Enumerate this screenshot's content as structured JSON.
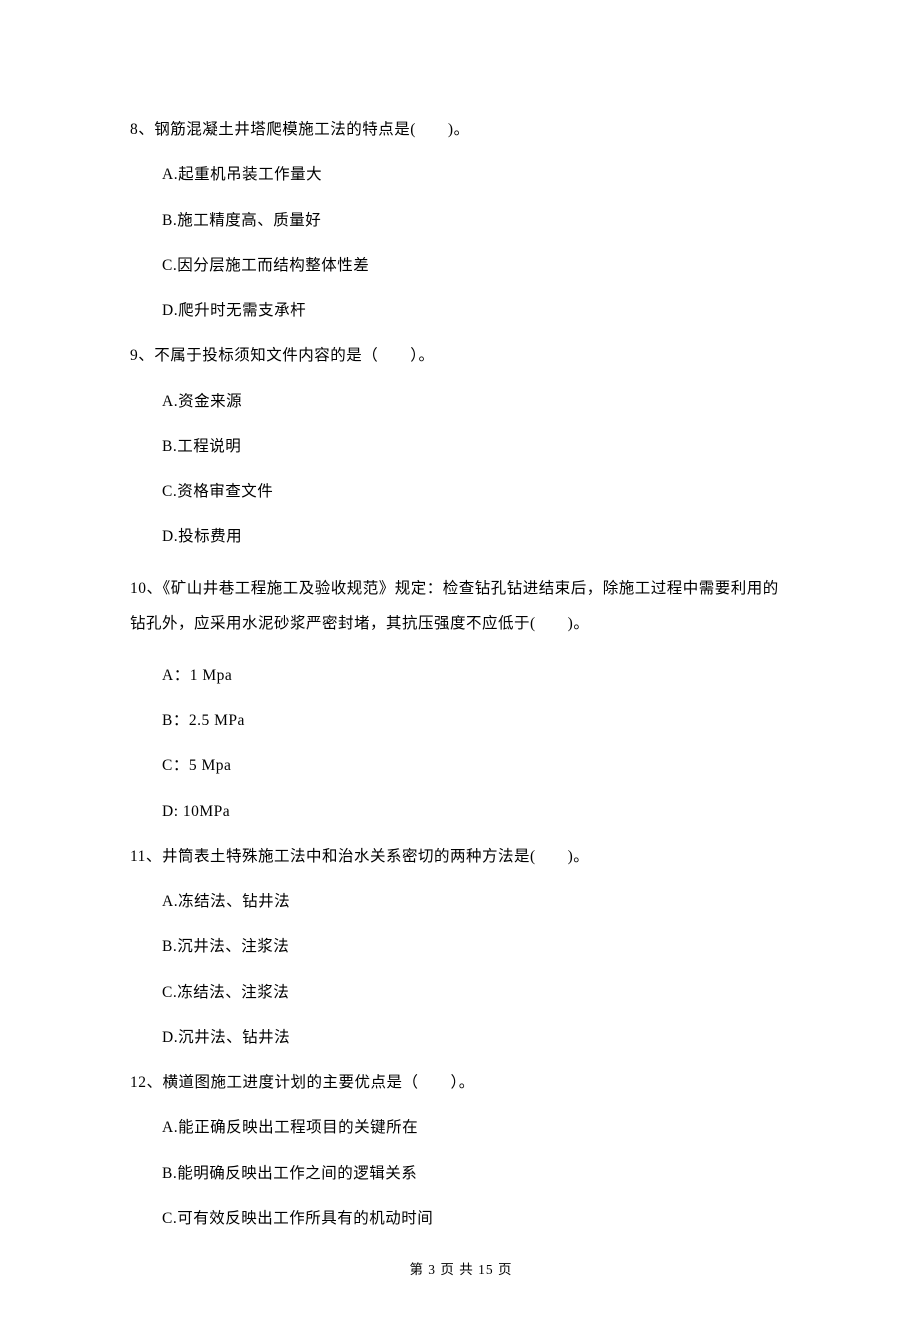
{
  "questions": [
    {
      "number": "8、",
      "text": "钢筋混凝土井塔爬模施工法的特点是(　　)。",
      "options": [
        "A.起重机吊装工作量大",
        "B.施工精度高、质量好",
        "C.因分层施工而结构整体性差",
        "D.爬升时无需支承杆"
      ]
    },
    {
      "number": "9、",
      "text": "不属于投标须知文件内容的是（　　）。",
      "options": [
        "A.资金来源",
        "B.工程说明",
        "C.资格审查文件",
        "D.投标费用"
      ]
    },
    {
      "number": "10、",
      "text": "《矿山井巷工程施工及验收规范》规定：检查钻孔钻进结束后，除施工过程中需要利用的钻孔外，应采用水泥砂浆严密封堵，其抗压强度不应低于(　　)。",
      "options": [
        "A：1 Mpa",
        "B：2.5 MPa",
        "C：5 Mpa",
        "D: 10MPa"
      ]
    },
    {
      "number": "11、",
      "text": "井筒表土特殊施工法中和治水关系密切的两种方法是(　　)。",
      "options": [
        "A.冻结法、钻井法",
        "B.沉井法、注浆法",
        "C.冻结法、注浆法",
        "D.沉井法、钻井法"
      ]
    },
    {
      "number": "12、",
      "text": "横道图施工进度计划的主要优点是（　　）。",
      "options": [
        "A.能正确反映出工程项目的关键所在",
        "B.能明确反映出工作之间的逻辑关系",
        "C.可有效反映出工作所具有的机动时间"
      ]
    }
  ],
  "footer": "第 3 页 共 15 页"
}
